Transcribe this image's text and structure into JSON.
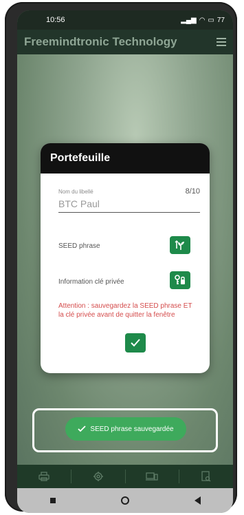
{
  "status_bar": {
    "time": "10:56",
    "battery": "77"
  },
  "app": {
    "title": "Freemindtronic Technology"
  },
  "dialog": {
    "title": "Portefeuille",
    "field_label": "Nom du libellé",
    "counter": "8/10",
    "field_value": "BTC Paul",
    "seed_label": "SEED phrase",
    "private_key_label": "Information clé privée",
    "warning": "Attention : sauvegardez la SEED phrase ET la clé privée avant de quitter la fenêtre"
  },
  "toast": {
    "message": "SEED phrase sauvegardée"
  },
  "bottom_tabs": [
    {
      "icon": "printer-icon"
    },
    {
      "icon": "gear-icon"
    },
    {
      "icon": "devices-icon"
    },
    {
      "icon": "document-search-icon"
    }
  ],
  "colors": {
    "accent_green": "#1e8a4a",
    "toast_green": "#3eaa5c",
    "warning_red": "#d44b4b"
  }
}
